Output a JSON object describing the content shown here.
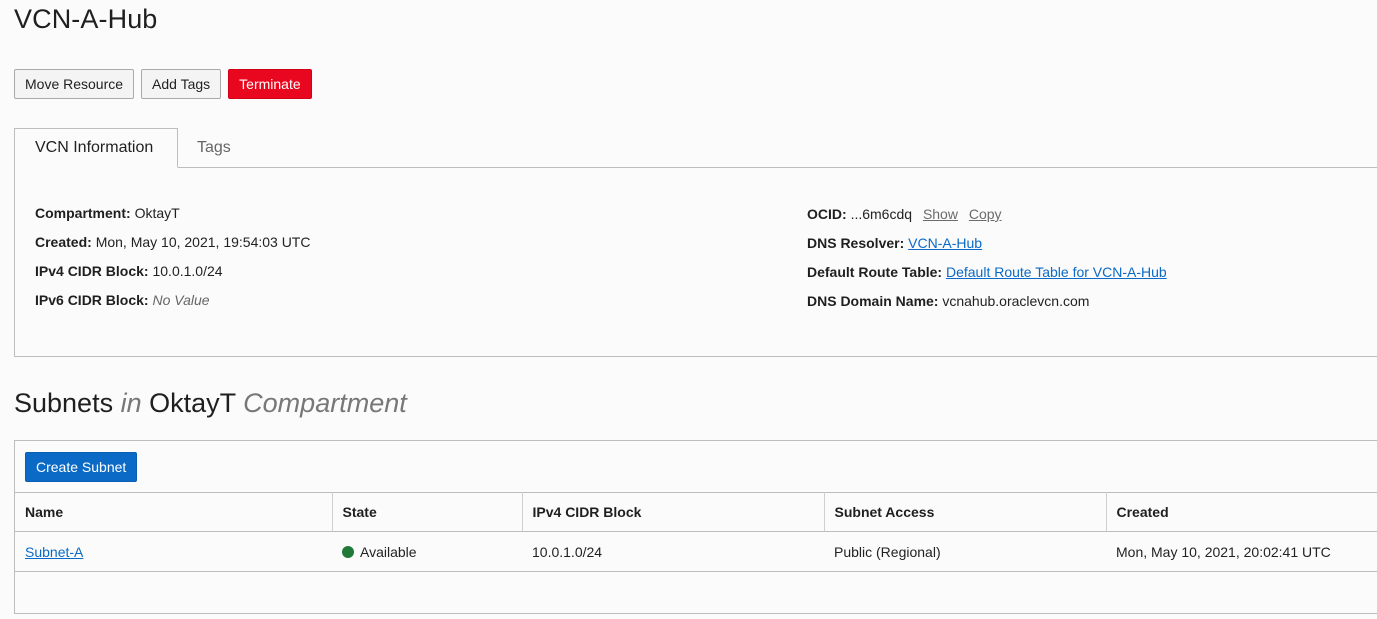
{
  "page": {
    "title": "VCN-A-Hub"
  },
  "toolbar": {
    "move_label": "Move Resource",
    "add_tags_label": "Add Tags",
    "terminate_label": "Terminate"
  },
  "tabs": [
    {
      "label": "VCN Information",
      "active": true
    },
    {
      "label": "Tags",
      "active": false
    }
  ],
  "info": {
    "compartment_label": "Compartment:",
    "compartment_value": "OktayT",
    "created_label": "Created:",
    "created_value": "Mon, May 10, 2021, 19:54:03 UTC",
    "ipv4_label": "IPv4 CIDR Block:",
    "ipv4_value": "10.0.1.0/24",
    "ipv6_label": "IPv6 CIDR Block:",
    "ipv6_value": "No Value",
    "ocid_label": "OCID:",
    "ocid_value": "...6m6cdq",
    "ocid_show": "Show",
    "ocid_copy": "Copy",
    "dns_resolver_label": "DNS Resolver:",
    "dns_resolver_value": "VCN-A-Hub",
    "route_table_label": "Default Route Table:",
    "route_table_value": "Default Route Table for VCN-A-Hub",
    "dns_domain_label": "DNS Domain Name:",
    "dns_domain_value": "vcnahub.oraclevcn.com"
  },
  "subnets": {
    "heading_main": "Subnets",
    "heading_in": "in",
    "heading_compartment": "OktayT",
    "heading_suffix": "Compartment",
    "create_label": "Create Subnet",
    "columns": [
      "Name",
      "State",
      "IPv4 CIDR Block",
      "Subnet Access",
      "Created"
    ],
    "rows": [
      {
        "name": "Subnet-A",
        "state": "Available",
        "state_color": "#1f7a3a",
        "cidr": "10.0.1.0/24",
        "access": "Public (Regional)",
        "created": "Mon, May 10, 2021, 20:02:41 UTC"
      }
    ]
  },
  "colors": {
    "danger": "#e8071e",
    "primary": "#0a6ac6",
    "link": "#0a6ac6"
  }
}
